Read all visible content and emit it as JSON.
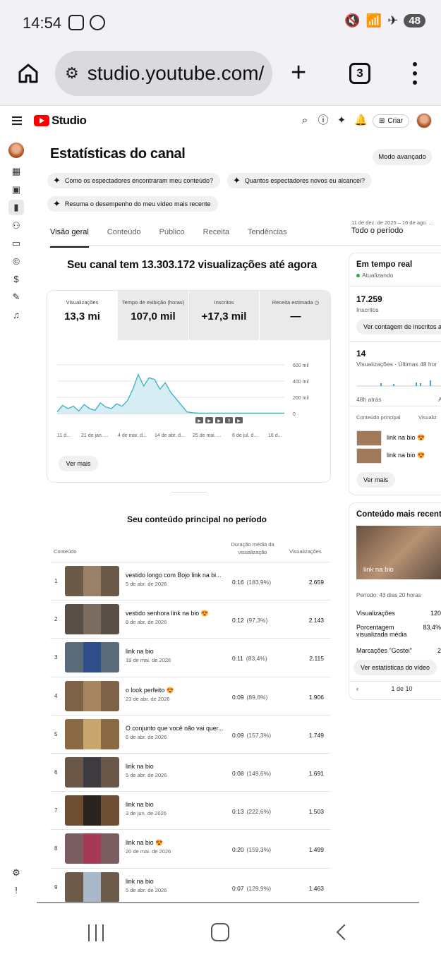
{
  "status": {
    "time": "14:54",
    "battery": "48"
  },
  "browser": {
    "url": "studio.youtube.com/",
    "tab_count": "3"
  },
  "header": {
    "brand": "Studio",
    "create_label": "Criar"
  },
  "page": {
    "title": "Estatísticas do canal",
    "advanced_button": "Modo avançado",
    "chips": [
      "Como os espectadores encontraram meu conteúdo?",
      "Quantos espectadores novos eu alcancei?",
      "Resuma o desempenho do meu vídeo mais recente"
    ],
    "tabs": [
      "Visão geral",
      "Conteúdo",
      "Público",
      "Receita",
      "Tendências"
    ],
    "active_tab": "Visão geral",
    "date_range": "11 de dez. de 2025 – 16 de ago. ...",
    "period": "Todo o período"
  },
  "overview": {
    "headline": "Seu canal tem 13.303.172 visualizações até agora",
    "metrics": [
      {
        "label": "Visualizações",
        "value": "13,3 mi"
      },
      {
        "label": "Tempo de exibição (horas)",
        "value": "107,0 mil"
      },
      {
        "label": "Inscritos",
        "value": "+17,3 mil"
      },
      {
        "label": "Receita estimada",
        "value": "—"
      }
    ],
    "see_more": "Ver mais"
  },
  "chart_data": {
    "type": "area",
    "y_ticks": [
      "600 mil",
      "400 mil",
      "200 mil",
      "0"
    ],
    "ylim": [
      0,
      600000
    ],
    "x_tick_labels": [
      "11 d...",
      "21 de jan. ...",
      "4 de mar. d...",
      "14 de abr. d...",
      "25 de mai. ...",
      "6 de jul. d...",
      "16 d..."
    ],
    "values": [
      20000,
      100000,
      60000,
      90000,
      30000,
      110000,
      60000,
      40000,
      130000,
      80000,
      60000,
      120000,
      90000,
      160000,
      300000,
      480000,
      340000,
      440000,
      420000,
      300000,
      380000,
      260000,
      180000,
      100000,
      20000,
      10000,
      5000,
      5000,
      5000,
      5000,
      5000,
      5000,
      5000,
      5000,
      5000,
      5000,
      5000,
      5000,
      5000,
      5000,
      5000,
      5000,
      5000
    ],
    "markers": [
      "▶",
      "▶",
      "▶",
      "9",
      "▶"
    ],
    "grid": true
  },
  "realtime": {
    "title": "Em tempo real",
    "updating": "Atualizando",
    "subscribers": "17.259",
    "subscribers_label": "Inscritos",
    "sub_button": "Ver contagem de inscritos a",
    "views48": "14",
    "views48_label": "Visualizações · Últimas 48 hor",
    "axis_left": "48h atrás",
    "axis_right": "A",
    "col_content": "Conteúdo principal",
    "col_views": "Visualiz",
    "videos": [
      "link na bio 😍",
      "link na bio 😍"
    ],
    "see_more": "Ver mais"
  },
  "recent": {
    "title": "Conteúdo mais recente",
    "thumb_label": "link na bio",
    "period": "Período: 43 dias 20 horas",
    "rows": [
      {
        "label": "Visualizações",
        "value": "120"
      },
      {
        "label": "Porcentagem visualizada média",
        "value": "83,4%"
      },
      {
        "label": "Marcações \"Gostei\"",
        "value": "2"
      }
    ],
    "button": "Ver estatísticas do vídeo",
    "pager": "1 de 10"
  },
  "top_content": {
    "title": "Seu conteúdo principal no período",
    "col_content": "Conteúdo",
    "col_duration": "Duração média da visualização",
    "col_views": "Visualizações",
    "rows": [
      {
        "n": "1",
        "title": "vestido longo com Bojo link na bi...",
        "date": "5 de abr. de 2026",
        "duration": "0:16",
        "pct": "(183,9%)",
        "views": "2.659"
      },
      {
        "n": "2",
        "title": "vestido senhora link na bio 😍",
        "date": "8 de abr. de 2026",
        "duration": "0:12",
        "pct": "(97,3%)",
        "views": "2.143"
      },
      {
        "n": "3",
        "title": "link na bio",
        "date": "19 de mai. de 2026",
        "duration": "0:11",
        "pct": "(83,4%)",
        "views": "2.115"
      },
      {
        "n": "4",
        "title": "o look perfeito 😍",
        "date": "23 de abr. de 2026",
        "duration": "0:09",
        "pct": "(89,6%)",
        "views": "1.906"
      },
      {
        "n": "5",
        "title": "O conjunto que você não vai quer...",
        "date": "6 de abr. de 2026",
        "duration": "0:09",
        "pct": "(157,3%)",
        "views": "1.749"
      },
      {
        "n": "6",
        "title": "link na bio",
        "date": "5 de abr. de 2026",
        "duration": "0:08",
        "pct": "(149,6%)",
        "views": "1.691"
      },
      {
        "n": "7",
        "title": "link na bio",
        "date": "3 de jun. de 2026",
        "duration": "0:13",
        "pct": "(222,6%)",
        "views": "1.503"
      },
      {
        "n": "8",
        "title": "link na bio 😍",
        "date": "20 de mai. de 2026",
        "duration": "0:20",
        "pct": "(159,3%)",
        "views": "1.499"
      },
      {
        "n": "9",
        "title": "link na bio",
        "date": "5 de abr. de 2026",
        "duration": "0:07",
        "pct": "(129,9%)",
        "views": "1.463"
      }
    ]
  },
  "colors": {
    "accent": "#ff0000",
    "chart_line": "#41b4c8",
    "chart_fill": "#d6eef3"
  }
}
